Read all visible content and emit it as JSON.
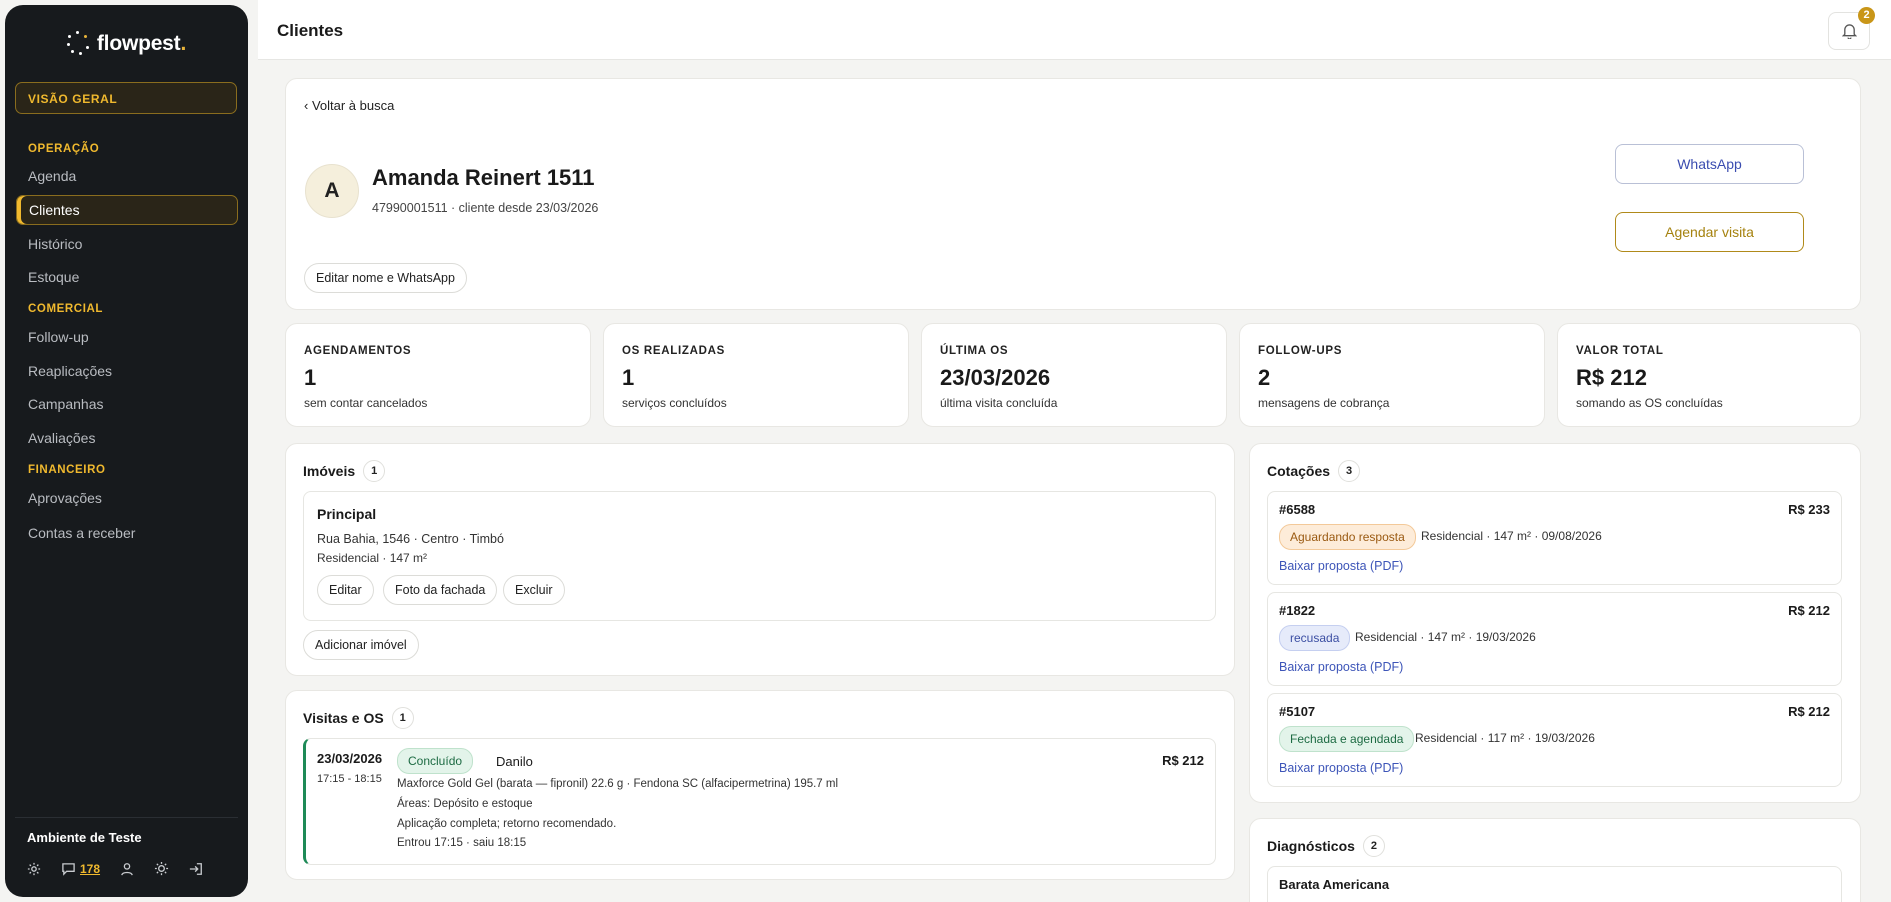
{
  "sidebar": {
    "brand": "flowpest",
    "brand_dot": ".",
    "overview": "VISÃO GERAL",
    "sections": {
      "operacao": "OPERAÇÃO",
      "comercial": "COMERCIAL",
      "financeiro": "FINANCEIRO"
    },
    "items": {
      "agenda": "Agenda",
      "clientes": "Clientes",
      "historico": "Histórico",
      "estoque": "Estoque",
      "followup": "Follow-up",
      "reaplicacoes": "Reaplicações",
      "campanhas": "Campanhas",
      "avaliacoes": "Avaliações",
      "aprovacoes": "Aprovações",
      "contas": "Contas a receber"
    },
    "environment": "Ambiente de Teste",
    "messages_count": "178"
  },
  "header": {
    "title": "Clientes",
    "notifications": "2"
  },
  "client": {
    "back": "‹ Voltar à busca",
    "initial": "A",
    "name": "Amanda Reinert 1511",
    "subtitle": "47990001511 · cliente desde 23/03/2026",
    "edit": "Editar nome e WhatsApp",
    "whatsapp": "WhatsApp",
    "schedule": "Agendar visita"
  },
  "stats": [
    {
      "label": "AGENDAMENTOS",
      "value": "1",
      "sub": "sem contar cancelados"
    },
    {
      "label": "OS REALIZADAS",
      "value": "1",
      "sub": "serviços concluídos"
    },
    {
      "label": "ÚLTIMA OS",
      "value": "23/03/2026",
      "sub": "última visita concluída"
    },
    {
      "label": "FOLLOW-UPS",
      "value": "2",
      "sub": "mensagens de cobrança"
    },
    {
      "label": "VALOR TOTAL",
      "value": "R$ 212",
      "sub": "somando as OS concluídas"
    }
  ],
  "imoveis": {
    "title": "Imóveis",
    "count": "1",
    "item": {
      "name": "Principal",
      "address": "Rua Bahia, 1546 · Centro · Timbó",
      "detail": "Residencial · 147 m²",
      "edit": "Editar",
      "photo": "Foto da fachada",
      "delete": "Excluir"
    },
    "add": "Adicionar imóvel"
  },
  "visitas": {
    "title": "Visitas e OS",
    "count": "1",
    "item": {
      "date": "23/03/2026",
      "time": "17:15 - 18:15",
      "status": "Concluído",
      "tech": "Danilo",
      "value": "R$ 212",
      "products": "Maxforce Gold Gel (barata — fipronil) 22.6 g · Fendona SC (alfacipermetrina) 195.7 ml",
      "areas": "Áreas: Depósito e estoque",
      "notes": "Aplicação completa; retorno recomendado.",
      "checkin": "Entrou 17:15 · saiu 18:15"
    }
  },
  "cotacoes": {
    "title": "Cotações",
    "count": "3",
    "items": [
      {
        "id": "#6588",
        "value": "R$ 233",
        "status": "Aguardando resposta",
        "detail": "Residencial · 147 m² · 09/08/2026",
        "link": "Baixar proposta (PDF)",
        "badge_bg": "#fdecd9",
        "badge_fg": "#9a5a12",
        "badge_border": "#f3c999"
      },
      {
        "id": "#1822",
        "value": "R$ 212",
        "status": "recusada",
        "detail": "Residencial · 147 m² · 19/03/2026",
        "link": "Baixar proposta (PDF)",
        "badge_bg": "#e6ebfa",
        "badge_fg": "#3c4fa3",
        "badge_border": "#c5cff0"
      },
      {
        "id": "#5107",
        "value": "R$ 212",
        "status": "Fechada e agendada",
        "detail": "Residencial · 117 m² · 19/03/2026",
        "link": "Baixar proposta (PDF)",
        "badge_bg": "#e3f4ea",
        "badge_fg": "#1d6b43",
        "badge_border": "#bfe2cc"
      }
    ]
  },
  "diagnosticos": {
    "title": "Diagnósticos",
    "count": "2",
    "first": "Barata Americana"
  },
  "colors": {
    "accent": "#f0b92e",
    "sidebar": "#171a1d",
    "success": "#1e8a57",
    "link": "#3d55b8"
  }
}
